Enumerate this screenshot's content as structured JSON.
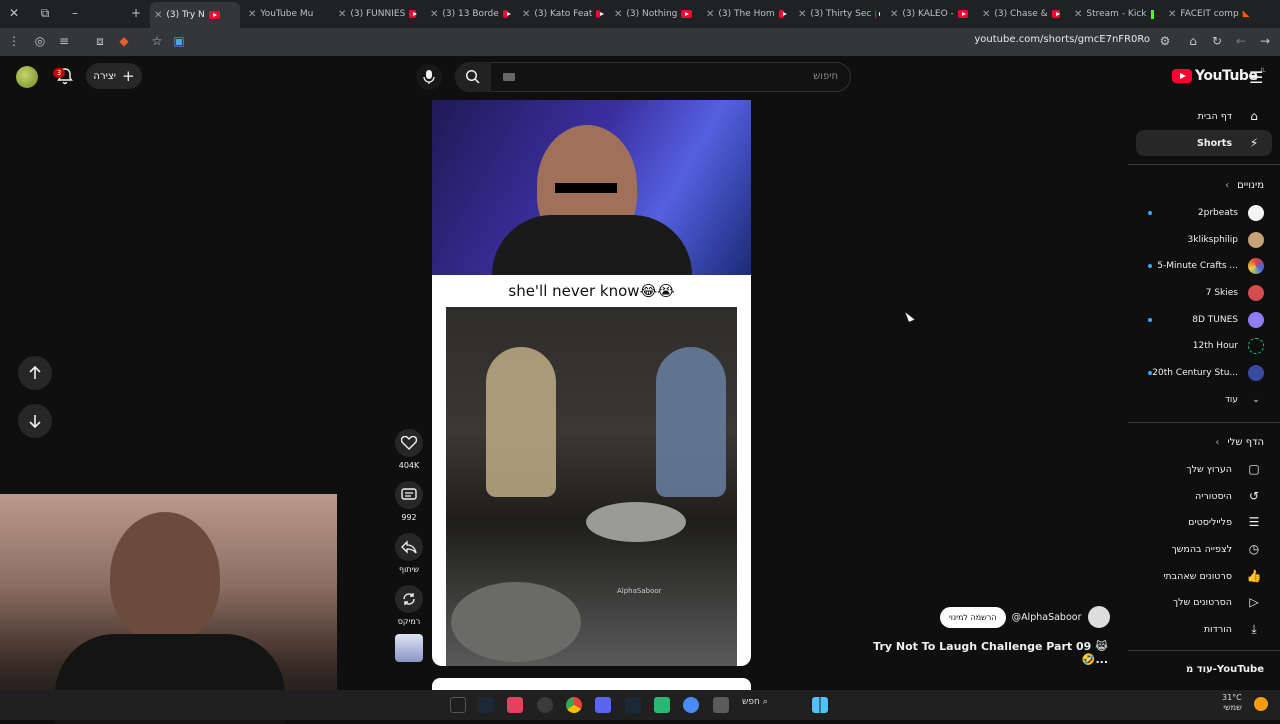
{
  "browser": {
    "tabs": [
      {
        "label": "(3) Try N",
        "active": true
      },
      {
        "label": "YouTube Mu"
      },
      {
        "label": "(3) FUNNIES"
      },
      {
        "label": "(3) 13 Borde"
      },
      {
        "label": "(3) Kato Feat"
      },
      {
        "label": "(3) Nothing"
      },
      {
        "label": "(3) The Hom"
      },
      {
        "label": "(3) Thirty Sec"
      },
      {
        "label": "(3) KALEO -"
      },
      {
        "label": "(3) Chase &"
      },
      {
        "label": "Stream - Kick"
      },
      {
        "label": "FACEIT comp"
      }
    ],
    "url": "youtube.com/shorts/gmcE7nFR0Ro"
  },
  "header": {
    "search_placeholder": "חיפוש",
    "create_label": "יצירה",
    "notification_count": "3",
    "logo_text": "YouTube",
    "logo_country": "IL"
  },
  "sidebar": {
    "nav": [
      {
        "label": "דף הבית",
        "icon": "home-icon"
      },
      {
        "label": "Shorts",
        "icon": "shorts-icon",
        "active": true
      }
    ],
    "subscriptions_title": "מינויים",
    "subscriptions": [
      {
        "label": "2prbeats",
        "dot": true,
        "color": "#f4f4f4"
      },
      {
        "label": "3kliksphilip",
        "dot": false,
        "color": "#c7a27a"
      },
      {
        "label": "5-Minute Crafts ...",
        "dot": true,
        "color": "#e63b3b"
      },
      {
        "label": "7 Skies",
        "dot": false,
        "color": "#d64b4b"
      },
      {
        "label": "8D TUNES",
        "dot": true,
        "color": "#8f7cf0"
      },
      {
        "label": "12th Hour",
        "dot": false,
        "color": "#2bb673"
      },
      {
        "label": "20th Century Stu...",
        "dot": true,
        "color": "#b88a3a"
      }
    ],
    "more_label": "עוד",
    "you_title": "הדף שלי",
    "you_items": [
      {
        "label": "הערוץ שלך",
        "icon": "channel-icon"
      },
      {
        "label": "היסטוריה",
        "icon": "history-icon"
      },
      {
        "label": "פלייליסטים",
        "icon": "playlists-icon"
      },
      {
        "label": "לצפייה בהמשך",
        "icon": "watch-later-icon"
      },
      {
        "label": "סרטונים שאהבתי",
        "icon": "liked-icon"
      },
      {
        "label": "הסרטונים שלך",
        "icon": "your-videos-icon"
      },
      {
        "label": "הורדות",
        "icon": "downloads-icon"
      }
    ],
    "more_from_youtube": "עוד מ-YouTube"
  },
  "short": {
    "caption": "she'll never know😂😭",
    "watermark": "AlphaSaboor",
    "likes": "404K",
    "comments": "992",
    "share_label": "שיתוף",
    "remix_label": "רמיקס",
    "channel": "@AlphaSaboor",
    "subscribe_label": "הרשמה למינוי",
    "title": "Try Not To Laugh Challenge Part 09 😹🤣..."
  },
  "taskbar": {
    "search_label": "חפש",
    "temperature": "31°C",
    "weather": "שמשי"
  }
}
